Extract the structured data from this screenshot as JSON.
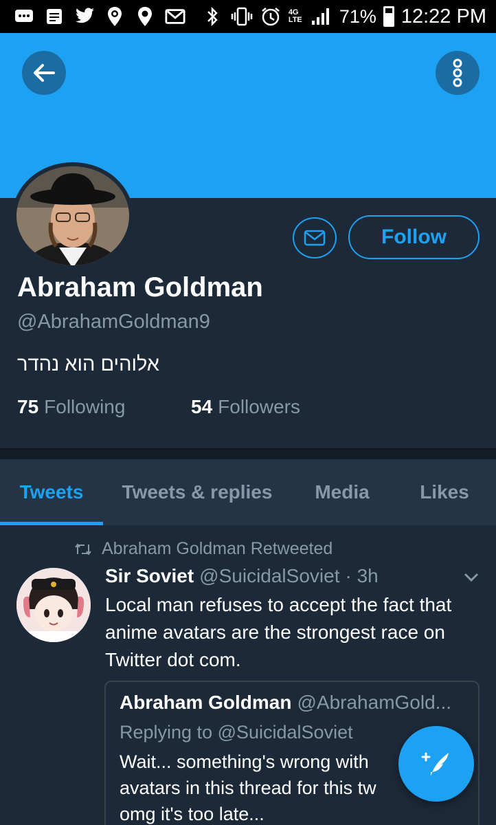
{
  "status_bar": {
    "battery": "71%",
    "time": "12:22 PM",
    "network": "4G LTE"
  },
  "profile": {
    "name": "Abraham Goldman",
    "handle": "@AbrahamGoldman9",
    "bio": "אלוהים הוא נהדר",
    "follow_label": "Follow",
    "following_count": "75",
    "following_label": "Following",
    "followers_count": "54",
    "followers_label": "Followers"
  },
  "tabs": [
    {
      "label": "Tweets",
      "active": true
    },
    {
      "label": "Tweets & replies",
      "active": false
    },
    {
      "label": "Media",
      "active": false
    },
    {
      "label": "Likes",
      "active": false
    }
  ],
  "tweet": {
    "retweet_note": "Abraham Goldman Retweeted",
    "author_name": "Sir Soviet",
    "author_handle": "@SuicidalSoviet",
    "time": "· 3h",
    "text": "Local man refuses to accept the fact that anime avatars are the strongest race on Twitter dot com.",
    "quote": {
      "author_name": "Abraham Goldman",
      "author_handle": "@AbrahamGold...",
      "replying_to": "Replying to @SuicidalSoviet",
      "line1": "Wait... something's wrong with",
      "line2": "avatars in this thread for this tw",
      "line3": "omg it's too late..."
    }
  },
  "colors": {
    "accent": "#1da1f2",
    "background": "#1c2938",
    "muted": "#8899a6"
  }
}
